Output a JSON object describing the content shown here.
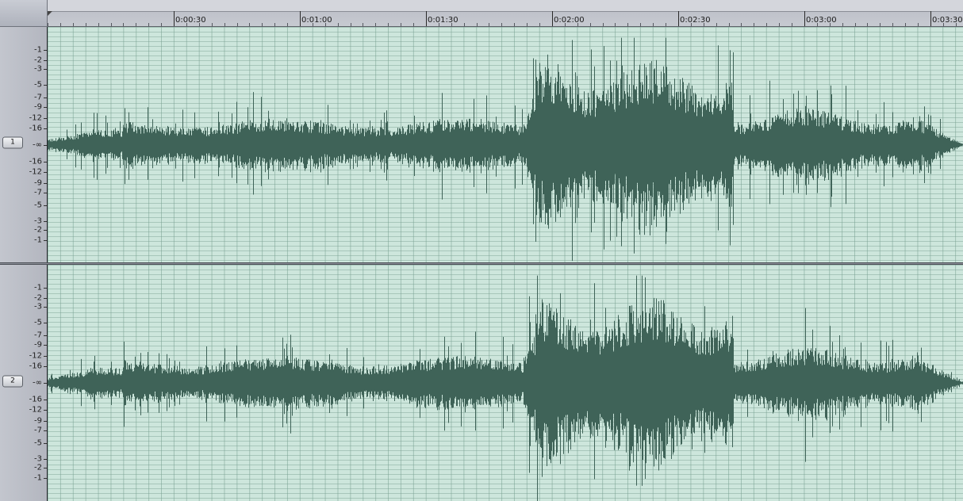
{
  "timeline": {
    "labels": [
      "0:00:30",
      "0:01:00",
      "0:01:30",
      "0:02:00",
      "0:02:30",
      "0:03:00",
      "0:03:30"
    ]
  },
  "channels": [
    {
      "id": "1",
      "label": "1"
    },
    {
      "id": "2",
      "label": "2"
    }
  ],
  "amplitude_scale": {
    "top_labels": [
      "-1",
      "-2",
      "-3",
      "-5",
      "-7",
      "-9",
      "-12",
      "-16"
    ],
    "center_label": "-∞",
    "bottom_labels": [
      "-16",
      "-12",
      "-9",
      "-7",
      "-5",
      "-3",
      "-2",
      "-1"
    ]
  },
  "colors": {
    "waveform": "#3f6358",
    "background": "#cde6dc"
  }
}
